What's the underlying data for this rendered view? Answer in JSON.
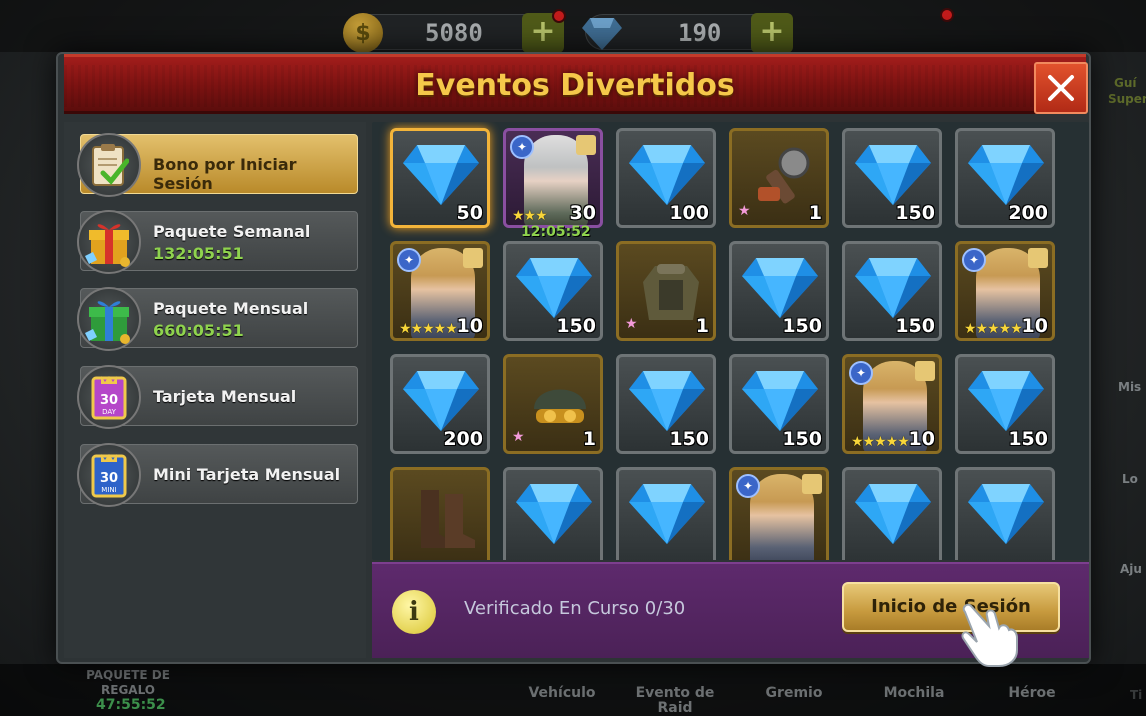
{
  "window": {
    "title": "Eventos Divertidos"
  },
  "top_bar": {
    "coins": "5080",
    "coins_icon": "$",
    "gems": "190",
    "plus": "+"
  },
  "menu": [
    {
      "label": "Bono por Iniciar Sesión",
      "timer": "",
      "icon": "clipboard-check-icon",
      "active": true
    },
    {
      "label": "Paquete Semanal",
      "timer": "132:05:51",
      "icon": "gift-box-icon"
    },
    {
      "label": "Paquete Mensual",
      "timer": "660:05:51",
      "icon": "gift-box-green-icon"
    },
    {
      "label": "Tarjeta Mensual",
      "timer": "",
      "icon": "monthly-card-icon",
      "card_text": "30 DAY"
    },
    {
      "label": "Mini Tarjeta Mensual",
      "timer": "",
      "icon": "mini-monthly-card-icon",
      "card_text": "30 MINI"
    }
  ],
  "rewards": [
    [
      {
        "type": "gem",
        "qty": "50",
        "highlight": true
      },
      {
        "type": "hero-silver",
        "qty": "30",
        "stars": "★★★",
        "timer": "12:05:52"
      },
      {
        "type": "gem",
        "qty": "100"
      },
      {
        "type": "chainsaw",
        "qty": "1",
        "stars": "★"
      },
      {
        "type": "gem",
        "qty": "150"
      },
      {
        "type": "gem",
        "qty": "200"
      }
    ],
    [
      {
        "type": "hero-blonde",
        "qty": "10",
        "stars": "★★★★★"
      },
      {
        "type": "gem",
        "qty": "150"
      },
      {
        "type": "jacket",
        "qty": "1",
        "stars": "★"
      },
      {
        "type": "gem",
        "qty": "150"
      },
      {
        "type": "gem",
        "qty": "150"
      },
      {
        "type": "hero-blonde",
        "qty": "10",
        "stars": "★★★★★"
      }
    ],
    [
      {
        "type": "gem",
        "qty": "200"
      },
      {
        "type": "helmet",
        "qty": "1",
        "stars": "★"
      },
      {
        "type": "gem",
        "qty": "150"
      },
      {
        "type": "gem",
        "qty": "150"
      },
      {
        "type": "hero-blonde",
        "qty": "10",
        "stars": "★★★★★"
      },
      {
        "type": "gem",
        "qty": "150"
      }
    ],
    [
      {
        "type": "boots",
        "qty": ""
      },
      {
        "type": "gem",
        "qty": ""
      },
      {
        "type": "gem",
        "qty": ""
      },
      {
        "type": "hero-blonde",
        "qty": ""
      },
      {
        "type": "gem",
        "qty": ""
      },
      {
        "type": "gem",
        "qty": ""
      }
    ]
  ],
  "status": {
    "info_icon": "i",
    "text": "Verificado En Curso 0/30",
    "button": "Inicio de Sesión"
  },
  "bottom_nav": {
    "gift_label": "PAQUETE DE REGALO",
    "gift_timer": "47:55:52",
    "items": [
      "Vehículo",
      "Evento de Raid",
      "Gremio",
      "Mochila",
      "Héroe"
    ]
  },
  "side_labels": [
    "Guí",
    "Super",
    "Mis",
    "Lo",
    "Aju",
    "Ti"
  ],
  "colors": {
    "title": "#f5c84a",
    "accent_gold": "#c79a3e",
    "timer_green": "#8fd34e",
    "status_purple": "#5e2a6d"
  }
}
